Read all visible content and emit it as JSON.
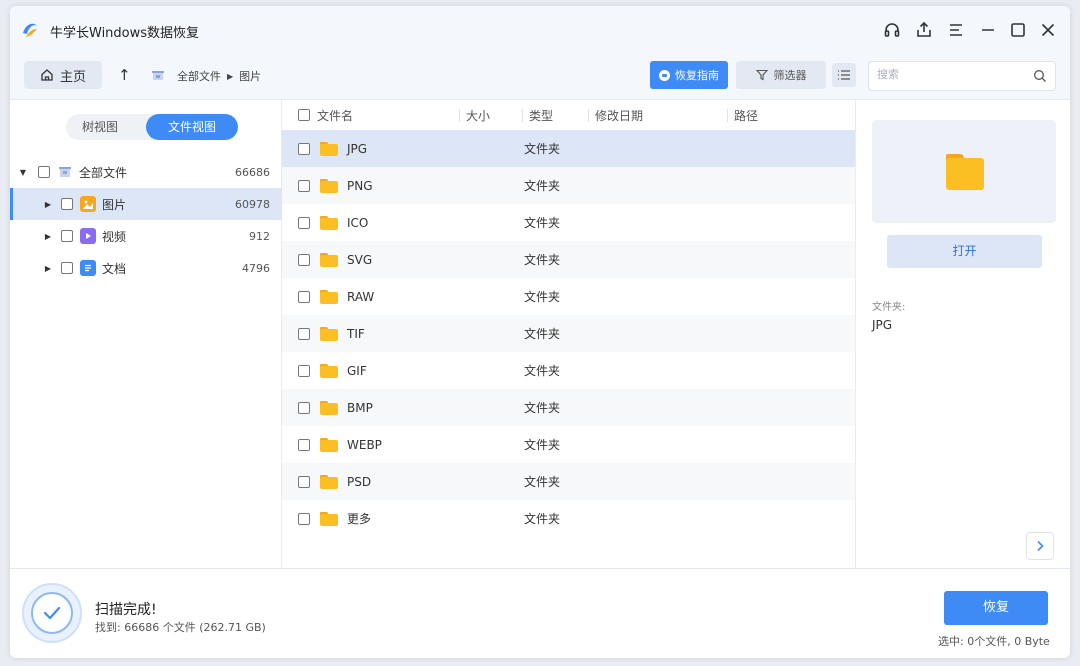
{
  "app": {
    "title": "牛学长Windows数据恢复"
  },
  "toolbar": {
    "home_label": "主页",
    "breadcrumb": [
      "全部文件",
      "图片"
    ],
    "guide_label": "恢复指南",
    "filter_label": "筛选器",
    "search_placeholder": "搜索"
  },
  "sidebar": {
    "tabs": [
      "树视图",
      "文件视图"
    ],
    "active_tab": "文件视图",
    "items": [
      {
        "label": "全部文件",
        "count": "66686",
        "icon": "all-files-icon"
      },
      {
        "label": "图片",
        "count": "60978",
        "icon": "image-icon",
        "color": "#f5a623"
      },
      {
        "label": "视频",
        "count": "912",
        "icon": "video-icon",
        "color": "#8b6cf0"
      },
      {
        "label": "文档",
        "count": "4796",
        "icon": "document-icon",
        "color": "#3e8bf5"
      }
    ]
  },
  "file_list": {
    "columns": [
      "文件名",
      "大小",
      "类型",
      "修改日期",
      "路径"
    ],
    "rows": [
      {
        "name": "JPG",
        "type": "文件夹"
      },
      {
        "name": "PNG",
        "type": "文件夹"
      },
      {
        "name": "ICO",
        "type": "文件夹"
      },
      {
        "name": "SVG",
        "type": "文件夹"
      },
      {
        "name": "RAW",
        "type": "文件夹"
      },
      {
        "name": "TIF",
        "type": "文件夹"
      },
      {
        "name": "GIF",
        "type": "文件夹"
      },
      {
        "name": "BMP",
        "type": "文件夹"
      },
      {
        "name": "WEBP",
        "type": "文件夹"
      },
      {
        "name": "PSD",
        "type": "文件夹"
      },
      {
        "name": "更多",
        "type": "文件夹"
      }
    ]
  },
  "preview": {
    "open_label": "打开",
    "folder_label": "文件夹:",
    "folder_name": "JPG"
  },
  "status": {
    "title": "扫描完成!",
    "subtitle": "找到: 66686 个文件 (262.71 GB)",
    "recover_label": "恢复",
    "selected_info": "选中: 0个文件, 0 Byte"
  },
  "colors": {
    "accent": "#3e8bf5",
    "folder": "#fbbf24",
    "selected_row": "#dde6f7"
  }
}
